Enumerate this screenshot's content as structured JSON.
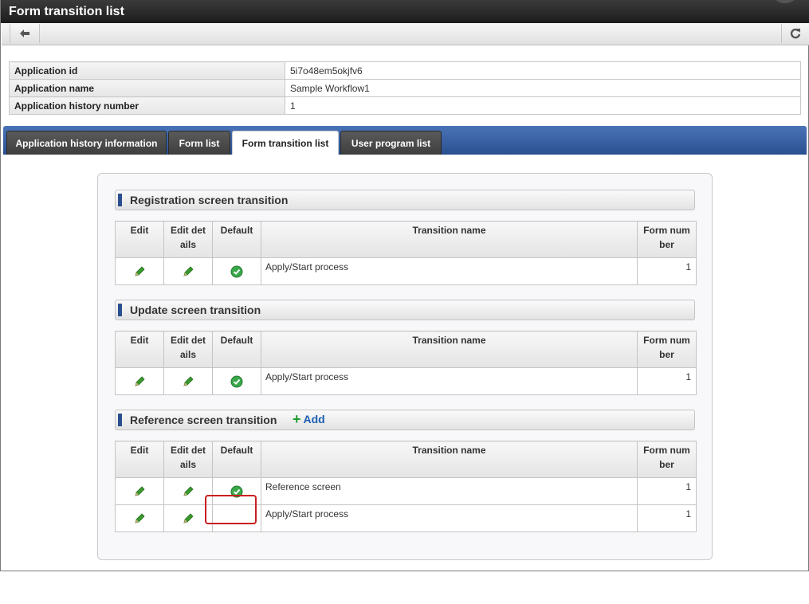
{
  "window": {
    "title": "Form transition list"
  },
  "toolbar": {
    "back_icon": "arrow-left-icon",
    "reload_icon": "refresh-icon"
  },
  "info": [
    {
      "key": "Application id",
      "value": "5i7o48em5okjfv6"
    },
    {
      "key": "Application name",
      "value": "Sample Workflow1"
    },
    {
      "key": "Application history number",
      "value": "1"
    }
  ],
  "tabs": [
    {
      "label": "Application history information",
      "active": false
    },
    {
      "label": "Form list",
      "active": false
    },
    {
      "label": "Form transition list",
      "active": true
    },
    {
      "label": "User program list",
      "active": false
    }
  ],
  "columns": {
    "edit": "Edit",
    "edit_details": "Edit det ails",
    "default": "Default",
    "name": "Transition name",
    "form_number": "Form num ber"
  },
  "sections": [
    {
      "title": "Registration screen transition",
      "rows": [
        {
          "name": "Apply/Start process",
          "default": true,
          "form_number": "1"
        }
      ]
    },
    {
      "title": "Update screen transition",
      "rows": [
        {
          "name": "Apply/Start process",
          "default": true,
          "form_number": "1"
        }
      ]
    },
    {
      "title": "Reference screen transition",
      "add_label": "Add",
      "rows": [
        {
          "name": "Reference screen",
          "default": true,
          "form_number": "1"
        },
        {
          "name": "Apply/Start process",
          "default": false,
          "form_number": "1"
        }
      ]
    }
  ],
  "colors": {
    "accent": "#2a4f8f",
    "highlight": "#c81e1e",
    "check": "#3aa84a",
    "pencil": "#3a9a2e"
  }
}
